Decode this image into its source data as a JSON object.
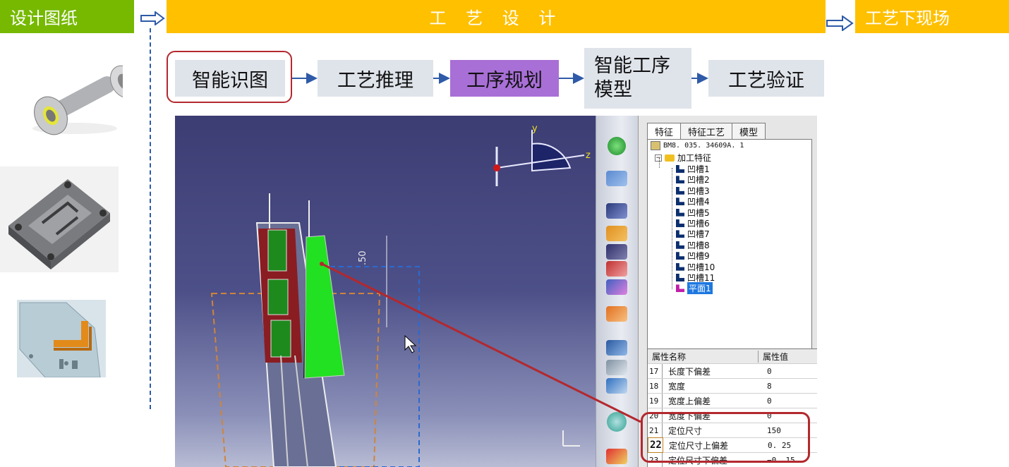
{
  "header": {
    "left_label": "设计图纸",
    "center_label": "工 艺 设 计",
    "right_label": "工艺下现场"
  },
  "steps": [
    {
      "label": "智能识图",
      "highlighted": true
    },
    {
      "label": "工艺推理"
    },
    {
      "label": "工序规划",
      "active_color": "#a86fd6"
    },
    {
      "label_line1": "智能工序",
      "label_line2": "模型"
    },
    {
      "label": "工艺验证"
    }
  ],
  "colors": {
    "green_bar": "#76b900",
    "yellow_bar": "#ffc000",
    "active_step": "#a86fd6",
    "step_bg": "#dfe3ea",
    "highlight": "#b3282e",
    "arrow": "#2e5aa8"
  },
  "cad": {
    "axis_labels": {
      "y": "y",
      "z": "z"
    },
    "dim_text": ".50",
    "tabs": [
      "特征",
      "特征工艺",
      "模型"
    ],
    "tree": {
      "root": "BM8. 035. 34609A. 1",
      "group": "加工特征",
      "items": [
        "凹槽1",
        "凹槽2",
        "凹槽3",
        "凹槽4",
        "凹槽5",
        "凹槽6",
        "凹槽7",
        "凹槽8",
        "凹槽9",
        "凹槽10",
        "凹槽11"
      ],
      "selected": "平面1"
    },
    "property_table": {
      "header_name": "属性名称",
      "header_value": "属性值",
      "rows": [
        {
          "num": "17",
          "name": "长度下偏差",
          "value": "0"
        },
        {
          "num": "18",
          "name": "宽度",
          "value": "8"
        },
        {
          "num": "19",
          "name": "宽度上偏差",
          "value": "0"
        },
        {
          "num": "20",
          "name": "宽度下偏差",
          "value": "0"
        },
        {
          "num": "21",
          "name": "定位尺寸",
          "value": "150"
        },
        {
          "num": "22",
          "name": "定位尺寸上偏差",
          "value": "0. 25"
        },
        {
          "num": "23",
          "name": "定位尺寸下偏差",
          "value": "−0. 15"
        }
      ]
    }
  }
}
